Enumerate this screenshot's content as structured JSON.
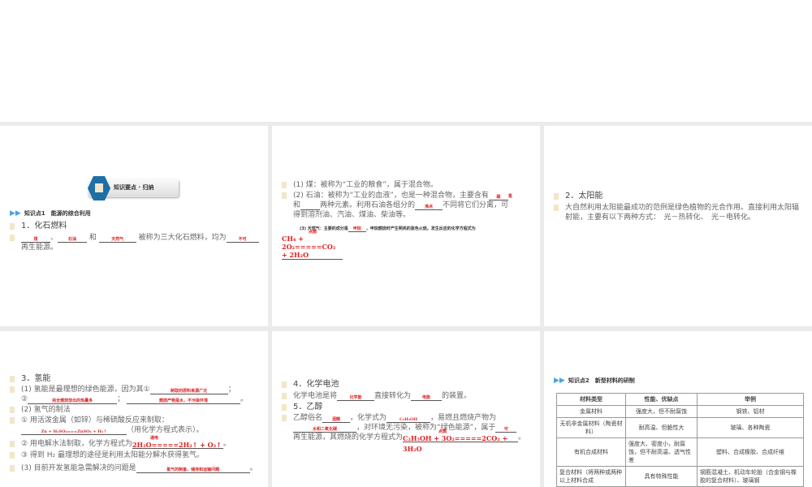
{
  "p1": {
    "banner": "知识要点 · 归纳",
    "kp": "知识点1　能源的综合利用",
    "h1": "1．化石燃料",
    "a1": "煤",
    "sep1": "、",
    "a2": "石油",
    "and": "和",
    "a3": "天然气",
    "t1": "被称为三大化石燃料，均为",
    "a4": "不可",
    "t2": "再生能源。"
  },
  "p2": {
    "l1": "(1) 煤：被称为“工业的粮食”，属于混合物。",
    "l2a": "(2) 石油：被称为“工业的血液”，也是一种混合物，主要含有",
    "a1": "碳",
    "a2": "氢",
    "l2b": "和",
    "l2c": "两种元素。利用石油各组分的",
    "a3": "沸点",
    "l2d": "不同将它们分离，可",
    "l2e": "得到溶剂油、汽油、煤油、柴油等。",
    "l3a": "(3) 天然气：主要的成分是",
    "a4": "甲烷",
    "l3b": "，甲烷燃烧时产生明亮的蓝色火焰，发生反应的化学方程式为",
    "cond": "点燃",
    "eq": "CH₄ + 2O₂=====CO₂ + 2H₂O",
    "end": "。"
  },
  "p3": {
    "h": "2．太阳能",
    "text": "大自然利用太阳能最成功的范例是绿色植物的光合作用。直接利用太阳辐射能，主要有以下两种方式：　光－热转化、　光－电转化。"
  },
  "p4": {
    "h": "3．氢能",
    "l1": "(1) 氢能是最理想的绿色能源，因为其①",
    "a1": "制取的原料来源广泛",
    "c1": "；",
    "n2": "②",
    "a2": "完全燃烧放出的热量多",
    "c2": "；",
    "n3": "③",
    "a3": "燃烧产物是水，不污染环境",
    "end": "。",
    "l2": "(2) 氢气的制法",
    "l3": "① 用活泼金属（如锌）与稀硫酸反应来制取：",
    "a4": "Zn + H₂SO₄===ZnSO₄ + H₂↑",
    "l3b": "（用化学方程式表示）。",
    "l4": "② 用电解水法制取，化学方程式为",
    "cond": "通电",
    "eq": "2H₂O=====2H₂↑ + O₂↑",
    "l5": "③ 得到 H₂ 最理想的途径是利用太阳能分解水获得氢气。",
    "l6": "(3) 目前开发氢能急需解决的问题是",
    "a5": "氢气的制备、储存和运输问题"
  },
  "p5": {
    "h4": "4．化学电池",
    "l1a": "化学电池是将",
    "a1": "化学能",
    "l1b": "直接转化为",
    "a2": "电能",
    "l1c": "的装置。",
    "h5": "5．乙醇",
    "l2a": "乙醇俗名",
    "a3": "酒精",
    "l2b": "，化学式为",
    "a4": "C₂H₅OH",
    "l2c": "，易燃且燃烧产物为",
    "a5": "水和二氧化碳",
    "l3": "，对环境无污染，被称为“绿色能源”，属于",
    "a6": "可",
    "l4": "再生能源，其燃烧的化学方程式为",
    "cond": "点燃",
    "eq": "C₂H₅OH + 3O₂=====2CO₂ + 3H₂O",
    "end": "。"
  },
  "p6": {
    "kp": "知识点2　新型材料的研制",
    "headers": [
      "材料类型",
      "性能、优缺点",
      "举例"
    ],
    "rows": [
      [
        "金属材料",
        "强度大，但不耐腐蚀",
        "钢铁、铝材"
      ],
      [
        "无机非金属材料（陶瓷材料）",
        "耐高温、但脆性大",
        "玻璃、各种陶瓷"
      ],
      [
        "有机合成材料",
        "强度大、密度小，耐腐蚀，但不耐高温、透气性差",
        "塑料、合成橡胶、合成纤维"
      ],
      [
        "复合材料（将两种或两种以上材料合成",
        "具有特殊性能",
        "钢筋混凝土、机动车轮胎（合金钢与橡胶的复合材料）、玻璃钢"
      ]
    ]
  }
}
